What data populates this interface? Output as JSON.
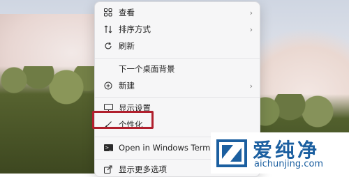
{
  "menu": {
    "items": [
      {
        "label": "查看",
        "icon": "grid-icon",
        "has_submenu": true
      },
      {
        "label": "排序方式",
        "icon": "sort-icon",
        "has_submenu": true
      },
      {
        "label": "刷新",
        "icon": "refresh-icon",
        "has_submenu": false
      },
      {
        "label": "下一个桌面背景",
        "icon": "",
        "has_submenu": false
      },
      {
        "label": "新建",
        "icon": "plus-circle-icon",
        "has_submenu": true
      },
      {
        "label": "显示设置",
        "icon": "monitor-icon",
        "has_submenu": false
      },
      {
        "label": "个性化",
        "icon": "brush-icon",
        "has_submenu": false,
        "highlighted": true
      },
      {
        "label": "Open in Windows Terminal",
        "icon": "terminal-icon",
        "has_submenu": false
      },
      {
        "label": "显示更多选项",
        "icon": "share-icon",
        "has_submenu": false
      }
    ],
    "submenu_arrow": "›"
  },
  "watermark": {
    "title": "爱纯净",
    "url": "aichunjing.com"
  },
  "colors": {
    "highlight_border": "#b01f2d",
    "watermark_blue": "#1b5fa0"
  }
}
